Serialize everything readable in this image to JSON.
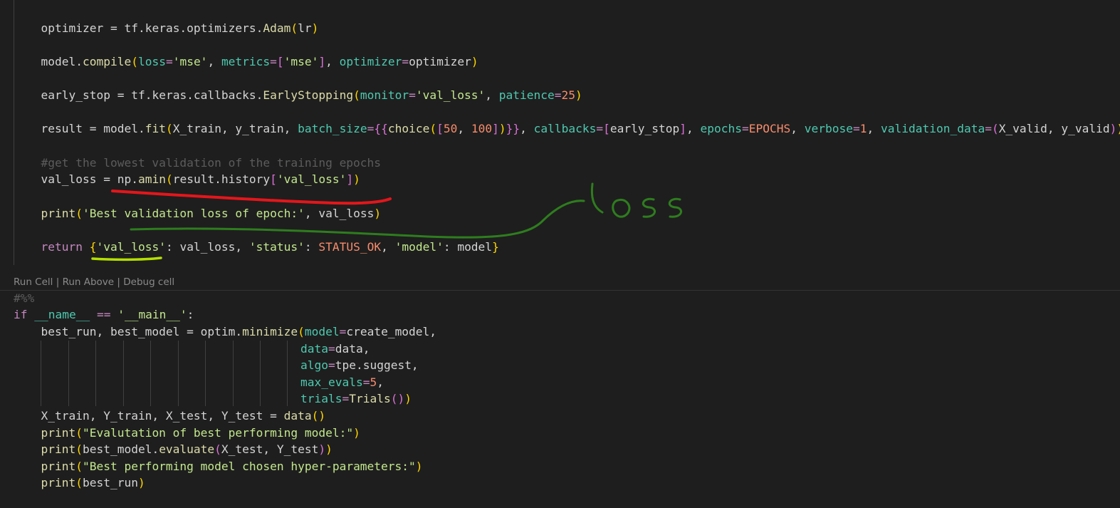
{
  "code": {
    "optimizer": {
      "var": "optimizer",
      "op": " = ",
      "obj": "tf.keras.optimizers.",
      "fn": "Adam",
      "open": "(",
      "arg": "lr",
      "close": ")"
    },
    "compile": {
      "obj": "model.",
      "fn": "compile",
      "open": "(",
      "p1": "loss",
      "eq1": "=",
      "s1": "'mse'",
      "c1": ", ",
      "p2": "metrics",
      "eq2": "=",
      "br_o": "[",
      "s2": "'mse'",
      "br_c": "]",
      "c2": ", ",
      "p3": "optimizer",
      "eq3": "=",
      "v3": "optimizer",
      "close": ")"
    },
    "early_stop": {
      "var": "early_stop",
      "op": " = ",
      "obj": "tf.keras.callbacks.",
      "fn": "EarlyStopping",
      "open": "(",
      "p1": "monitor",
      "eq1": "=",
      "s1": "'val_loss'",
      "c1": ", ",
      "p2": "patience",
      "eq2": "=",
      "n2": "25",
      "close": ")"
    },
    "fit": {
      "var": "result",
      "op": " = ",
      "obj": "model.",
      "fn": "fit",
      "open": "(",
      "a1": "X_train, y_train, ",
      "p1": "batch_size",
      "eq1": "=",
      "tpl_o": "{{",
      "fn2": "choice",
      "open2": "(",
      "br_o": "[",
      "n1": "50",
      "cm": ", ",
      "n2": "100",
      "br_c": "]",
      "close2": ")",
      "tpl_c": "}}",
      "c1": ", ",
      "p2": "callbacks",
      "eq2": "=",
      "br2_o": "[",
      "v2": "early_stop",
      "br2_c": "]",
      "c2": ", ",
      "p3": "epochs",
      "eq3": "=",
      "v3": "EPOCHS",
      "c3": ", ",
      "p4": "verbose",
      "eq4": "=",
      "n4": "1",
      "c4": ", ",
      "p5": "validation_data",
      "eq5": "=",
      "tup_o": "(",
      "v5": "X_valid, y_valid",
      "tup_c": ")",
      "close": ")"
    },
    "comment": "#get the lowest validation of the training epochs",
    "val_loss": {
      "var": "val_loss",
      "op": " = ",
      "obj": "np.",
      "fn": "amin",
      "open": "(",
      "arg": "result.history",
      "br_o": "[",
      "s": "'val_loss'",
      "br_c": "]",
      "close": ")"
    },
    "print1": {
      "fn": "print",
      "open": "(",
      "s": "'Best validation loss of epoch:'",
      "rest": ", val_loss",
      "close": ")"
    },
    "ret": {
      "kw": "return",
      "sp": " ",
      "open": "{",
      "s1": "'val_loss'",
      "r1": ": val_loss, ",
      "s2": "'status'",
      "r2": ": ",
      "v2": "STATUS_OK",
      "r3": ", ",
      "s3": "'model'",
      "r4": ": model",
      "close": "}"
    },
    "cell_marker": "#%%",
    "main_if": {
      "kw": "if",
      "sp": " ",
      "dunder": "__name__",
      "op": " == ",
      "s": "'__main__'",
      "colon": ":"
    },
    "minimize": {
      "var": "best_run, best_model = optim.",
      "fn": "minimize",
      "open": "(",
      "p": "model",
      "eq": "=",
      "v": "create_model,"
    },
    "min_data": {
      "p": "data",
      "eq": "=",
      "v": "data,"
    },
    "min_algo": {
      "p": "algo",
      "eq": "=",
      "v": "tpe.suggest,"
    },
    "min_evals": {
      "p": "max_evals",
      "eq": "=",
      "n": "5",
      "comma": ","
    },
    "min_trials": {
      "p": "trials",
      "eq": "=",
      "fn": "Trials",
      "open": "(",
      "close": ")",
      "close2": ")"
    },
    "data_line": {
      "var": "X_train, Y_train, X_test, Y_test = ",
      "fn": "data",
      "open": "(",
      "close": ")"
    },
    "print2": {
      "fn": "print",
      "open": "(",
      "s": "\"Evalutation of best performing model:\"",
      "close": ")"
    },
    "print3": {
      "fn": "print",
      "open": "(",
      "mid": "best_model.",
      "fn2": "evaluate",
      "open2": "(",
      "args": "X_test, Y_test",
      "close2": ")",
      "close": ")"
    },
    "print4": {
      "fn": "print",
      "open": "(",
      "s": "\"Best performing model chosen hyper-parameters:\"",
      "close": ")"
    },
    "print5": {
      "fn": "print",
      "open": "(",
      "arg": "best_run",
      "close": ")"
    }
  },
  "codelens": {
    "run_cell": "Run Cell",
    "sep1": " | ",
    "run_above": "Run Above",
    "sep2": " | ",
    "debug_cell": "Debug cell"
  },
  "annotation": {
    "handwritten_text": "loss",
    "red_color": "#e3161b",
    "green_color": "#2e7d1e",
    "lime_color": "#b4e000"
  }
}
